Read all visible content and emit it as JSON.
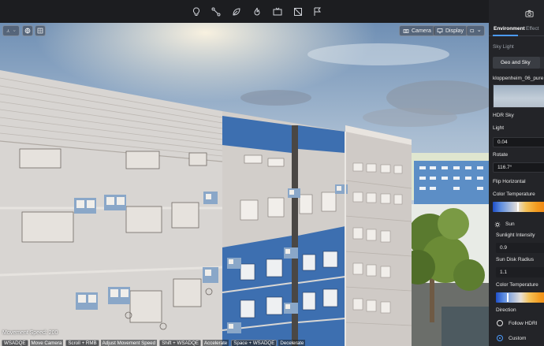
{
  "toolbar": {
    "tools": [
      "lightbulb-icon",
      "path-nodes-icon",
      "leaf-icon",
      "fire-icon",
      "media-icon",
      "no-image-icon",
      "flag-pin-icon"
    ]
  },
  "viewport": {
    "camera_label": "Camera",
    "display_label": "Display",
    "movement_speed": "Movement Speed: 200",
    "hints": [
      {
        "key": "WSADQE",
        "action": "Move Camera"
      },
      {
        "key": "Scroll + RMB",
        "action": "Adjust Movement Speed"
      },
      {
        "key": "Shift + WSADQE",
        "action": "Accelerate"
      },
      {
        "key": "Space + WSADQE",
        "action": "Decelerate"
      }
    ]
  },
  "panel": {
    "tabs": [
      {
        "label": "Environment",
        "active": true
      },
      {
        "label": "Effect",
        "active": false
      }
    ],
    "section_title": "Sky Light",
    "sky_mode": "Geo and Sky",
    "hdri_name": "kloppenheim_06_pure",
    "hdr_sky_label": "HDR Sky",
    "light_label": "Light",
    "light_value": "0.04",
    "rotate_label": "Rotate",
    "rotate_value": "116.7°",
    "flip_label": "Flip Horizontal",
    "color_temp_label": "Color Temperature",
    "sky_color_temp_fraction": 0.44,
    "sun_label": "Sun",
    "sunlight_intensity_label": "Sunlight Intensity",
    "sunlight_intensity_value": "0.9",
    "sun_disk_label": "Sun Disk Radius",
    "sun_disk_value": "1.1",
    "sun_color_temp_label": "Color Temperature",
    "sun_color_temp_fraction": 0.2,
    "direction_label": "Direction",
    "direction_options": [
      {
        "label": "Follow HDRI",
        "checked": false
      },
      {
        "label": "Custom",
        "checked": true
      }
    ]
  },
  "colors": {
    "accent": "#4b9bff",
    "panel_bg": "#232428",
    "toolbar_bg": "#1c1d20",
    "facade_blue": "#3f70b4",
    "facade_white": "#dcdad7"
  }
}
